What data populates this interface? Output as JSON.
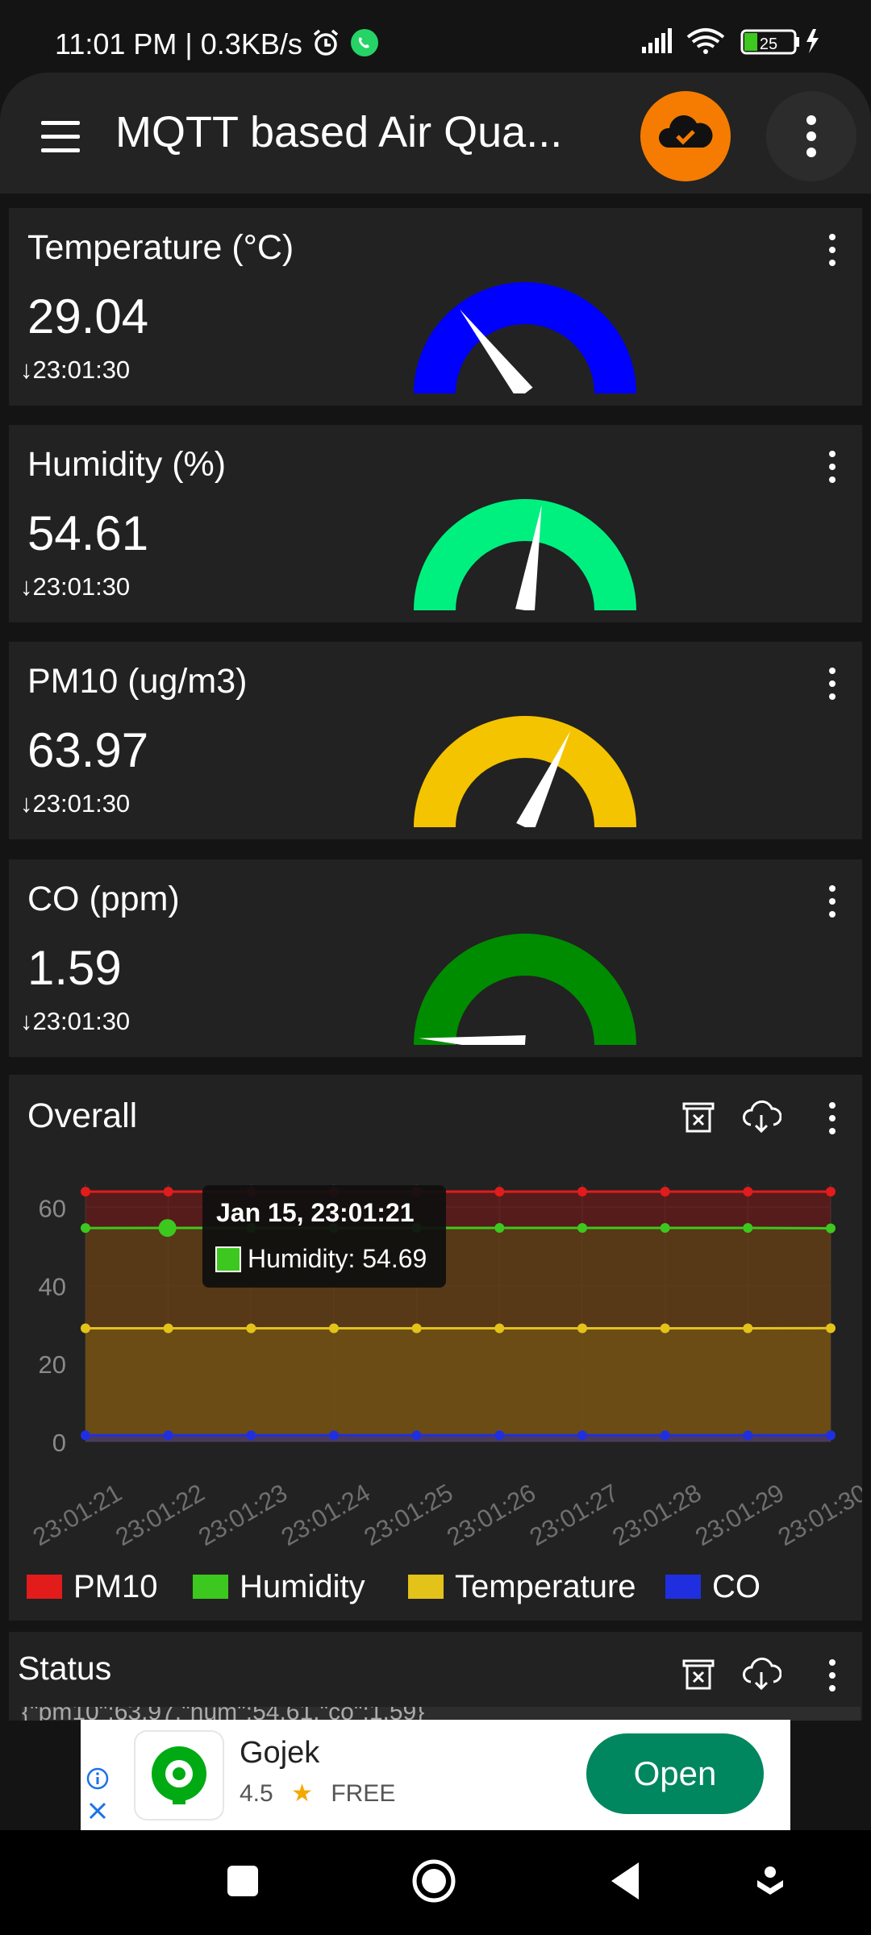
{
  "status_bar": {
    "left_text": "11:01 PM | 0.3KB/s",
    "battery": "25"
  },
  "app_bar": {
    "title": "MQTT based Air Qua..."
  },
  "tiles": [
    {
      "title": "Temperature (°C)",
      "value": "29.04",
      "time": "23:01:30",
      "color": "#0000ff",
      "needle_fraction": 0.29
    },
    {
      "title": "Humidity (%)",
      "value": "54.61",
      "time": "23:01:30",
      "color": "#00f080",
      "needle_fraction": 0.55
    },
    {
      "title": "PM10 (ug/m3)",
      "value": "63.97",
      "time": "23:01:30",
      "color": "#f5c400",
      "needle_fraction": 0.64
    },
    {
      "title": "CO (ppm)",
      "value": "1.59",
      "time": "23:01:30",
      "color": "#008c00",
      "needle_fraction": 0.02
    }
  ],
  "chart": {
    "title": "Overall",
    "tooltip": {
      "date": "Jan 15, 23:01:21",
      "text": "Humidity: 54.69"
    },
    "chart_data": {
      "type": "area",
      "categories": [
        "23:01:21",
        "23:01:22",
        "23:01:23",
        "23:01:24",
        "23:01:25",
        "23:01:26",
        "23:01:27",
        "23:01:28",
        "23:01:29",
        "23:01:30"
      ],
      "y_ticks": [
        "0",
        "20",
        "40",
        "60"
      ],
      "ylim": [
        0,
        64
      ],
      "grid": true,
      "legend_placement": "bottom",
      "series": [
        {
          "name": "PM10",
          "color": "#e21b1b",
          "values": [
            64,
            64,
            64,
            64,
            64,
            64,
            64,
            64,
            64,
            64
          ]
        },
        {
          "name": "Humidity",
          "color": "#3cc81e",
          "values": [
            54.69,
            54.7,
            54.7,
            54.7,
            54.7,
            54.7,
            54.7,
            54.7,
            54.7,
            54.61
          ]
        },
        {
          "name": "Temperature",
          "color": "#e3c21a",
          "values": [
            29,
            29,
            29,
            29,
            29,
            29,
            29,
            29,
            29,
            29.04
          ]
        },
        {
          "name": "CO",
          "color": "#1f2fe0",
          "values": [
            1.6,
            1.6,
            1.6,
            1.6,
            1.6,
            1.6,
            1.6,
            1.6,
            1.6,
            1.59
          ]
        }
      ]
    }
  },
  "status_tile": {
    "title": "Status",
    "text": "{\"pm10\":63.97,\"hum\":54.61,\"co\":1.59}"
  },
  "ad": {
    "app_name": "Gojek",
    "rating": "4.5",
    "price": "FREE",
    "button": "Open"
  }
}
